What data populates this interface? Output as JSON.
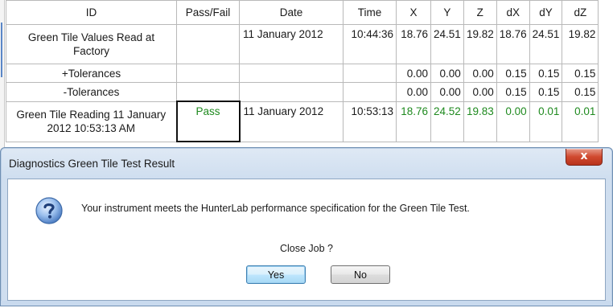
{
  "grid": {
    "columns": [
      "ID",
      "Pass/Fail",
      "Date",
      "Time",
      "X",
      "Y",
      "Z",
      "dX",
      "dY",
      "dZ"
    ],
    "rows": [
      {
        "id": "Green Tile Values Read at Factory",
        "pass_fail": "",
        "date": "11 January 2012",
        "time": "10:44:36",
        "x": "18.76",
        "y": "24.51",
        "z": "19.82",
        "dx": "18.76",
        "dy": "24.51",
        "dz": "19.82"
      },
      {
        "id": "+Tolerances",
        "pass_fail": "",
        "date": "",
        "time": "",
        "x": "0.00",
        "y": "0.00",
        "z": "0.00",
        "dx": "0.15",
        "dy": "0.15",
        "dz": "0.15"
      },
      {
        "id": "-Tolerances",
        "pass_fail": "",
        "date": "",
        "time": "",
        "x": "0.00",
        "y": "0.00",
        "z": "0.00",
        "dx": "0.15",
        "dy": "0.15",
        "dz": "0.15"
      },
      {
        "id": "Green Tile Reading 11 January 2012 10:53:13 AM",
        "pass_fail": "Pass",
        "date": "11 January 2012",
        "time": "10:53:13",
        "x": "18.76",
        "y": "24.52",
        "z": "19.83",
        "dx": "0.00",
        "dy": "0.01",
        "dz": "0.01"
      }
    ],
    "pass_color": "#1f8a1f"
  },
  "dialog": {
    "title": "Diagnostics Green Tile Test Result",
    "close_glyph": "x",
    "icon": "question-icon",
    "message": "Your instrument meets the HunterLab performance specification for the Green Tile Test.",
    "prompt": "Close Job ?",
    "yes_label": "Yes",
    "no_label": "No"
  }
}
